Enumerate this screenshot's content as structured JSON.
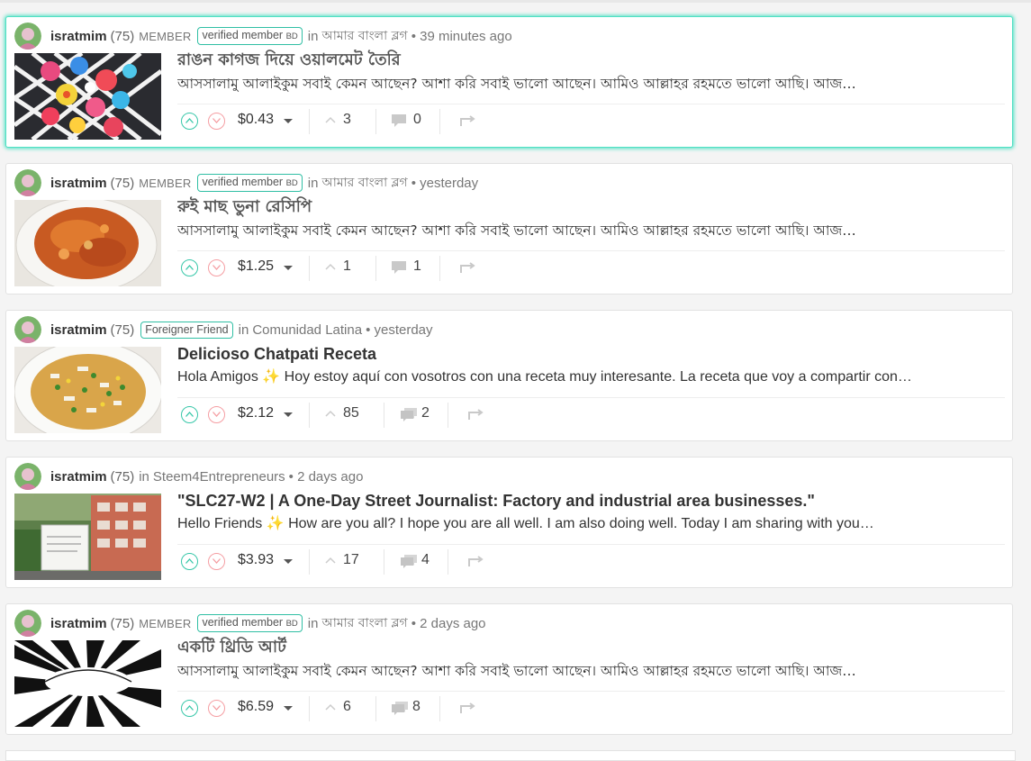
{
  "posts": [
    {
      "author": "isratmim",
      "reputation": "(75)",
      "member_label": "MEMBER",
      "badge": "verified member",
      "badge_suffix": "BD",
      "community_prefix": "in",
      "community": "আমার বাংলা ব্লগ",
      "time": "• 39 minutes ago",
      "title": "রাঙন কাগজ দিয়ে ওয়ালমেট তৈরি",
      "excerpt": "আসসালামু আলাইকুম সবাই কেমন আছেন? আশা করি সবাই ভালো আছেন। আমিও আল্লাহর রহমতে ভালো আছি। আজ…",
      "payout": "$0.43",
      "votes": "3",
      "comments": "0",
      "thumb": "flowers-on-grid"
    },
    {
      "author": "isratmim",
      "reputation": "(75)",
      "member_label": "MEMBER",
      "badge": "verified member",
      "badge_suffix": "BD",
      "community_prefix": "in",
      "community": "আমার বাংলা ব্লগ",
      "time": "• yesterday",
      "title": "রুই মাছ ভুনা রেসিপি",
      "excerpt": "আসসালামু আলাইকুম সবাই কেমন আছেন? আশা করি সবাই ভালো আছেন। আমিও আল্লাহর রহমতে ভালো আছি। আজ…",
      "payout": "$1.25",
      "votes": "1",
      "comments": "1",
      "thumb": "fish-curry-plate"
    },
    {
      "author": "isratmim",
      "reputation": "(75)",
      "member_label": "",
      "badge": "Foreigner Friend",
      "badge_suffix": "",
      "community_prefix": "in",
      "community": "Comunidad Latina",
      "time": "• yesterday",
      "title": "Delicioso Chatpati Receta",
      "excerpt": "Hola Amigos ✨ Hoy estoy aquí con vosotros con una receta muy interesante. La receta que voy a compartir con…",
      "payout": "$2.12",
      "votes": "85",
      "comments": "2",
      "thumb": "chatpati-plate"
    },
    {
      "author": "isratmim",
      "reputation": "(75)",
      "member_label": "",
      "badge": "",
      "badge_suffix": "",
      "community_prefix": "in",
      "community": "Steem4Entrepreneurs",
      "time": "• 2 days ago",
      "title": "\"SLC27-W2 | A One-Day Street Journalist: Factory and industrial area businesses.\"",
      "excerpt": "Hello Friends ✨ How are you all? I hope you are all well. I am also doing well. Today I am sharing with you…",
      "payout": "$3.93",
      "votes": "17",
      "comments": "4",
      "thumb": "street-building"
    },
    {
      "author": "isratmim",
      "reputation": "(75)",
      "member_label": "MEMBER",
      "badge": "verified member",
      "badge_suffix": "BD",
      "community_prefix": "in",
      "community": "আমার বাংলা ব্লগ",
      "time": "• 2 days ago",
      "title": "একটি থ্রিডি আর্ট",
      "excerpt": "আসসালামু আলাইকুম সবাই কেমন আছেন? আশা করি সবাই ভালো আছেন। আমিও আল্লাহর রহমতে ভালো আছি। আজ…",
      "payout": "$6.59",
      "votes": "6",
      "comments": "8",
      "thumb": "3d-stripe-art"
    }
  ],
  "colors": {
    "active_border": "#4fe0c4",
    "upvote": "#38c7a9",
    "downvote": "#f59ea3",
    "badge_border": "#30bfa4"
  }
}
